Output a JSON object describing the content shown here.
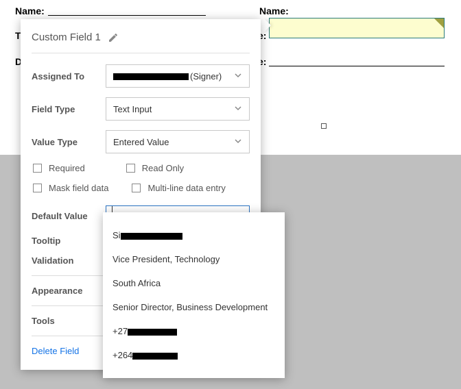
{
  "doc": {
    "name_label_1": "Name:",
    "name_label_2": "Name:",
    "ti_label": "Ti",
    "da_label": "Da",
    "e_label_1": "e:",
    "e_label_2": "e:"
  },
  "popup": {
    "title": "Custom Field 1",
    "assigned_to_label": "Assigned To",
    "assigned_to_suffix": "(Signer)",
    "field_type_label": "Field Type",
    "field_type_value": "Text Input",
    "value_type_label": "Value Type",
    "value_type_value": "Entered Value",
    "required_label": "Required",
    "readonly_label": "Read Only",
    "mask_label": "Mask field data",
    "multiline_label": "Multi-line data entry",
    "default_value_label": "Default Value",
    "default_value_text": "",
    "tooltip_label": "Tooltip",
    "validation_label": "Validation",
    "appearance_label": "Appearance",
    "tools_label": "Tools",
    "delete_label": "Delete Field"
  },
  "suggestions": {
    "item1_prefix": "Si",
    "item2": "Vice President, Technology",
    "item3": "South Africa",
    "item4": "Senior Director, Business Development",
    "item5_prefix": "+27",
    "item6_prefix": "+264"
  }
}
